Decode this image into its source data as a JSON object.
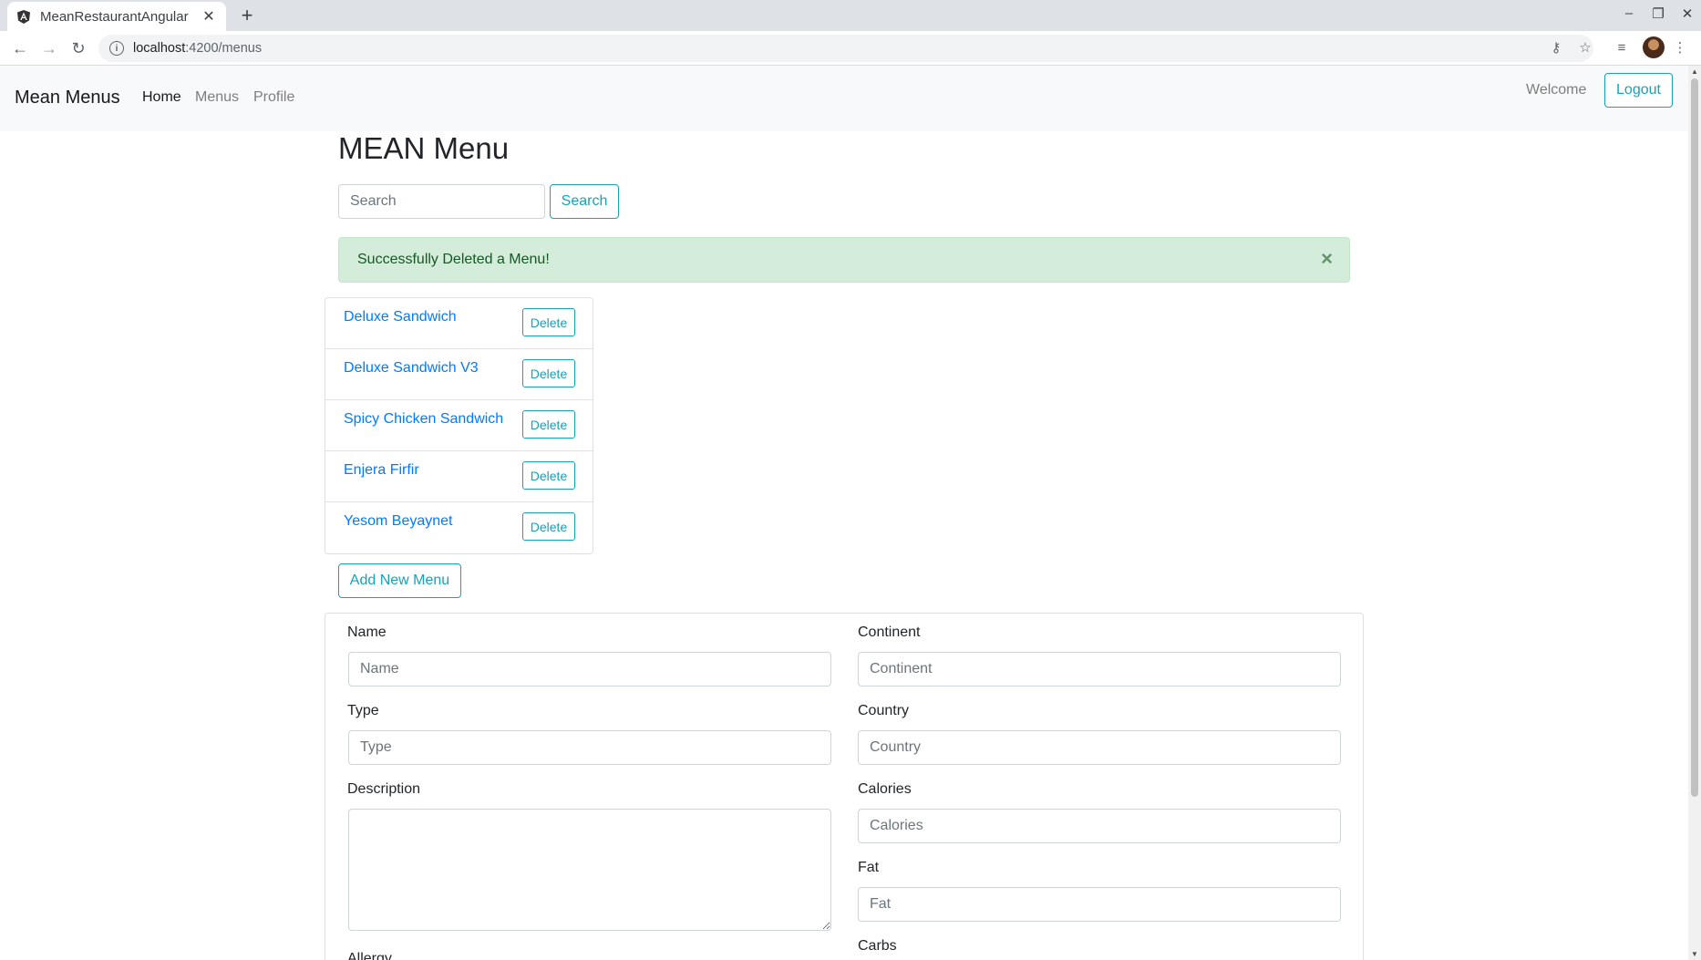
{
  "browser": {
    "tab_title": "MeanRestaurantAngular",
    "url_host": "localhost",
    "url_path": ":4200/menus"
  },
  "navbar": {
    "brand": "Mean Menus",
    "links": [
      {
        "label": "Home"
      },
      {
        "label": "Menus"
      },
      {
        "label": "Profile"
      }
    ],
    "welcome": "Welcome",
    "logout": "Logout"
  },
  "page": {
    "title": "MEAN Menu",
    "search_placeholder": "Search",
    "search_button": "Search",
    "alert": "Successfully Deleted a Menu!",
    "alert_close": "×",
    "add_button": "Add New Menu"
  },
  "menus": [
    {
      "name": "Deluxe Sandwich",
      "delete": "Delete"
    },
    {
      "name": "Deluxe Sandwich V3",
      "delete": "Delete"
    },
    {
      "name": "Spicy Chicken Sandwich",
      "delete": "Delete"
    },
    {
      "name": "Enjera Firfir",
      "delete": "Delete"
    },
    {
      "name": "Yesom Beyaynet",
      "delete": "Delete"
    }
  ],
  "form": {
    "name": {
      "label": "Name",
      "placeholder": "Name"
    },
    "type": {
      "label": "Type",
      "placeholder": "Type"
    },
    "description": {
      "label": "Description"
    },
    "allergy": {
      "label": "Allergy"
    },
    "continent": {
      "label": "Continent",
      "placeholder": "Continent"
    },
    "country": {
      "label": "Country",
      "placeholder": "Country"
    },
    "calories": {
      "label": "Calories",
      "placeholder": "Calories"
    },
    "fat": {
      "label": "Fat",
      "placeholder": "Fat"
    },
    "carbs": {
      "label": "Carbs"
    }
  },
  "colors": {
    "accent": "#17a2b8",
    "link": "#007bff",
    "alert_bg": "#d4edda",
    "alert_text": "#155724"
  }
}
